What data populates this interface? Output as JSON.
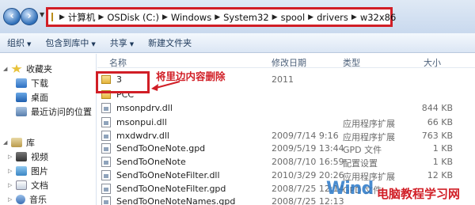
{
  "address_bar": {
    "crumbs": [
      "计算机",
      "OSDisk (C:)",
      "Windows",
      "System32",
      "spool",
      "drivers",
      "w32x86"
    ]
  },
  "toolbar": {
    "organize": "组织",
    "include_in_library": "包含到库中",
    "share": "共享",
    "new_folder": "新建文件夹"
  },
  "nav": {
    "favorites": "收藏夹",
    "downloads": "下载",
    "desktop": "桌面",
    "recent": "最近访问的位置",
    "libraries": "库",
    "videos": "视频",
    "pictures": "图片",
    "documents": "文档",
    "music": "音乐"
  },
  "columns": {
    "name": "名称",
    "date": "修改日期",
    "type": "类型",
    "size": "大小"
  },
  "files": [
    {
      "name": "3",
      "date": "2011",
      "type": "",
      "size": ""
    },
    {
      "name": "PCC",
      "date": "",
      "type": "",
      "size": ""
    },
    {
      "name": "msonpdrv.dll",
      "date": "",
      "type": "",
      "size": "844 KB"
    },
    {
      "name": "msonpui.dll",
      "date": "",
      "type": "应用程序扩展",
      "size": "66 KB"
    },
    {
      "name": "mxdwdrv.dll",
      "date": "2009/7/14 9:16",
      "type": "应用程序扩展",
      "size": "763 KB"
    },
    {
      "name": "SendToOneNote.gpd",
      "date": "2009/5/19 13:44",
      "type": "GPD 文件",
      "size": "1 KB"
    },
    {
      "name": "SendToOneNote",
      "date": "2008/7/10 16:59",
      "type": "配置设置",
      "size": "1 KB"
    },
    {
      "name": "SendToOneNoteFilter.dll",
      "date": "2010/3/29 20:26",
      "type": "应用程序扩展",
      "size": "12 KB"
    },
    {
      "name": "SendToOneNoteFilter.gpd",
      "date": "2008/7/25 12:14",
      "type": "GPD 文件",
      "size": ""
    },
    {
      "name": "SendToOneNoteNames.gpd",
      "date": "2008/7/25 12:13",
      "type": "",
      "size": ""
    }
  ],
  "annotation": {
    "text": "将里边内容删除"
  },
  "watermark": {
    "brand": "Wind",
    "site": "电脑教程学习网"
  }
}
